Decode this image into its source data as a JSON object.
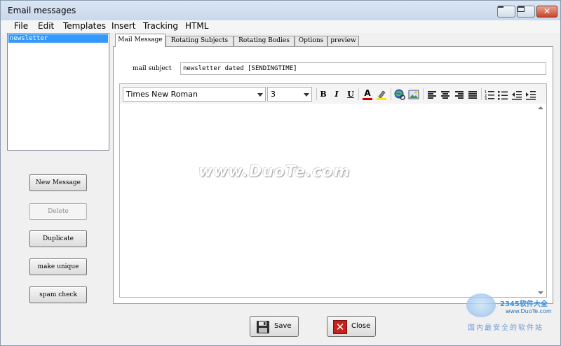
{
  "window": {
    "title": "Email messages"
  },
  "menu": [
    "File",
    "Edit",
    "Templates",
    "Insert",
    "Tracking",
    "HTML"
  ],
  "message_list": {
    "items": [
      "newsletter"
    ]
  },
  "side_buttons": {
    "new_message": "New Message",
    "delete": "Delete",
    "duplicate": "Duplicate",
    "make_unique": "make unique",
    "spam_check": "spam check"
  },
  "tabs": [
    "Mail Message",
    "Rotating Subjects",
    "Rotating Bodies",
    "Options",
    "preview"
  ],
  "mail": {
    "subject_label": "mail subject",
    "subject_value": "newsletter dated [SENDINGTIME]"
  },
  "editor": {
    "font_family": "Times New Roman",
    "font_size": "3",
    "bold": "B",
    "italic": "I",
    "underline": "U",
    "font_color_glyph": "A",
    "text_color": "#cc0000",
    "highlight_color": "#ffe800"
  },
  "footer": {
    "save_label": "Save",
    "close_label": "Close"
  },
  "watermark": {
    "main": "www.DuoTe.com",
    "corner_brand": "2345软件大全",
    "corner_url": "www.DuoTe.com",
    "corner_slogan": "国内最安全的软件站"
  }
}
